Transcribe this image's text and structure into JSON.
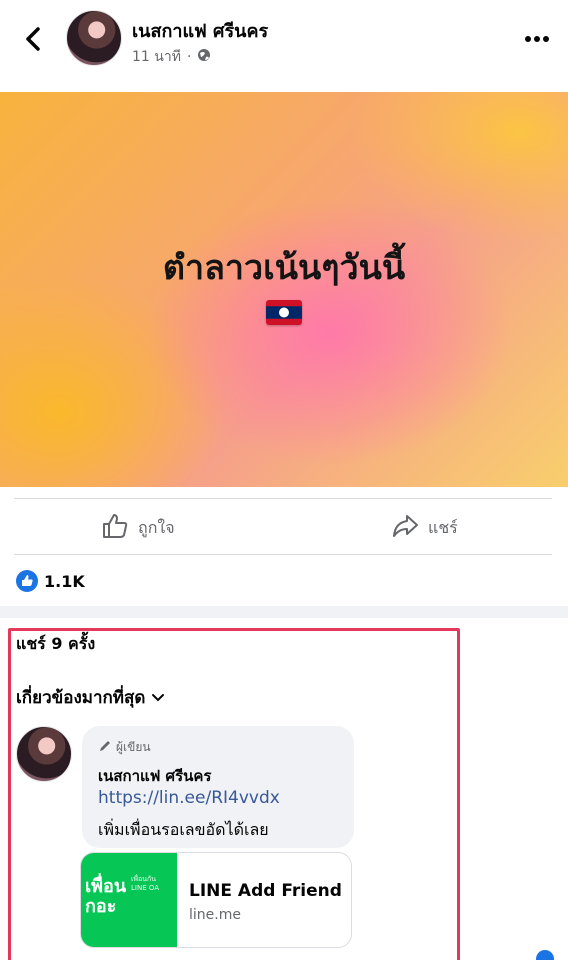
{
  "post": {
    "author_name": "เนสกาแฟ ศรีนคร",
    "time": "11 นาที",
    "separator": "·",
    "audience_icon": "globe-icon"
  },
  "hero": {
    "text": "ตำลาวเน้นๆวันนี้",
    "emoji": "laos-flag"
  },
  "actions": {
    "like_label": "ถูกใจ",
    "share_label": "แชร์"
  },
  "reactions": {
    "count": "1.1K"
  },
  "shares": {
    "label": "แชร์ 9 ครั้ง"
  },
  "comments": {
    "sort_label": "เกี่ยวข้องมากที่สุด",
    "items": [
      {
        "badge": "ผู้เขียน",
        "name": "เนสกาแฟ ศรีนคร",
        "link": "https://lin.ee/RI4vvdx",
        "text": "เพิ่มเพื่อนรอเลขอัดได้เลย",
        "preview": {
          "title": "LINE Add Friend",
          "domain": "line.me",
          "thumb_text": "เพื่อน\nกอะ"
        }
      }
    ]
  },
  "colors": {
    "highlight": "#e5375a",
    "like_blue": "#1b74e4",
    "link": "#385898",
    "line_green": "#06c755"
  }
}
